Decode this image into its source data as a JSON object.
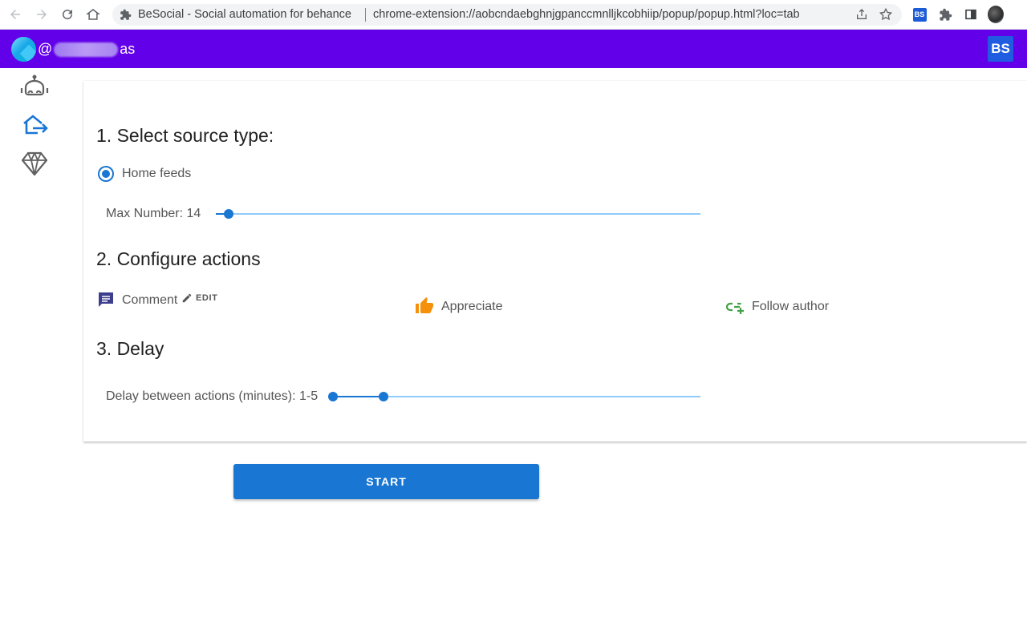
{
  "browser": {
    "tab_title": "BeSocial - Social automation for behance",
    "url": "chrome-extension://aobcndaebghnjgpanccmnlljkcobhiip/popup/popup.html?loc=tab",
    "extension_badge": "BS",
    "icons": [
      "back-icon",
      "forward-icon",
      "reload-icon",
      "home-icon",
      "extension-icon",
      "share-icon",
      "star-icon",
      "puzzle-icon",
      "sidepanel-icon",
      "profile-avatar"
    ]
  },
  "header": {
    "username_prefix": "@",
    "username_suffix": "as",
    "logo": "BS"
  },
  "sidebar": {
    "items": [
      {
        "icon": "robot-icon",
        "color": "#616161"
      },
      {
        "icon": "house-arrow-icon",
        "color": "#1976d2"
      },
      {
        "icon": "diamond-icon",
        "color": "#616161"
      }
    ]
  },
  "sections": {
    "source": {
      "title": "1. Select source type:",
      "option": "Home feeds",
      "max_label": "Max Number: 14",
      "max_value": 14
    },
    "actions": {
      "title": "2. Configure actions",
      "comment": "Comment",
      "edit": "EDIT",
      "appreciate": "Appreciate",
      "follow": "Follow author"
    },
    "delay": {
      "title": "3. Delay",
      "label": "Delay between actions (minutes): 1-5",
      "min": 1,
      "max": 5
    }
  },
  "start_button": "START",
  "colors": {
    "header_bg": "#6200ea",
    "primary": "#1976d2",
    "comment_icon": "#3d3d8f",
    "appreciate_icon": "#f5900b",
    "follow_icon": "#43a047"
  }
}
